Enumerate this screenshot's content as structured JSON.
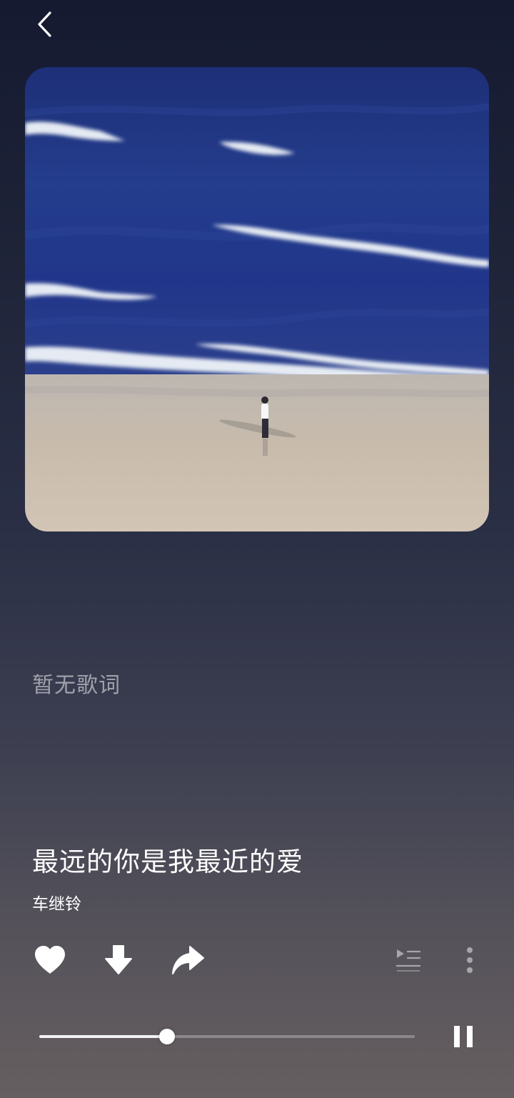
{
  "header": {
    "back_icon": "chevron-left-icon"
  },
  "player": {
    "cover_image": "album-cover-beach-ocean",
    "lyrics_placeholder": "暂无歌词",
    "song_title": "最远的你是我最近的爱",
    "artist": "车继铃",
    "progress_fraction": 0.34,
    "is_playing": true
  },
  "actions": {
    "like_icon": "heart-icon",
    "download_icon": "download-arrow-icon",
    "share_icon": "share-arrow-icon",
    "playlist_icon": "playlist-icon",
    "more_icon": "more-vertical-icon",
    "pause_icon": "pause-icon"
  },
  "colors": {
    "accent": "#ffffff",
    "progress_track": "#5e5c67",
    "background_top": "#151a31",
    "background_bottom": "#665f60"
  }
}
